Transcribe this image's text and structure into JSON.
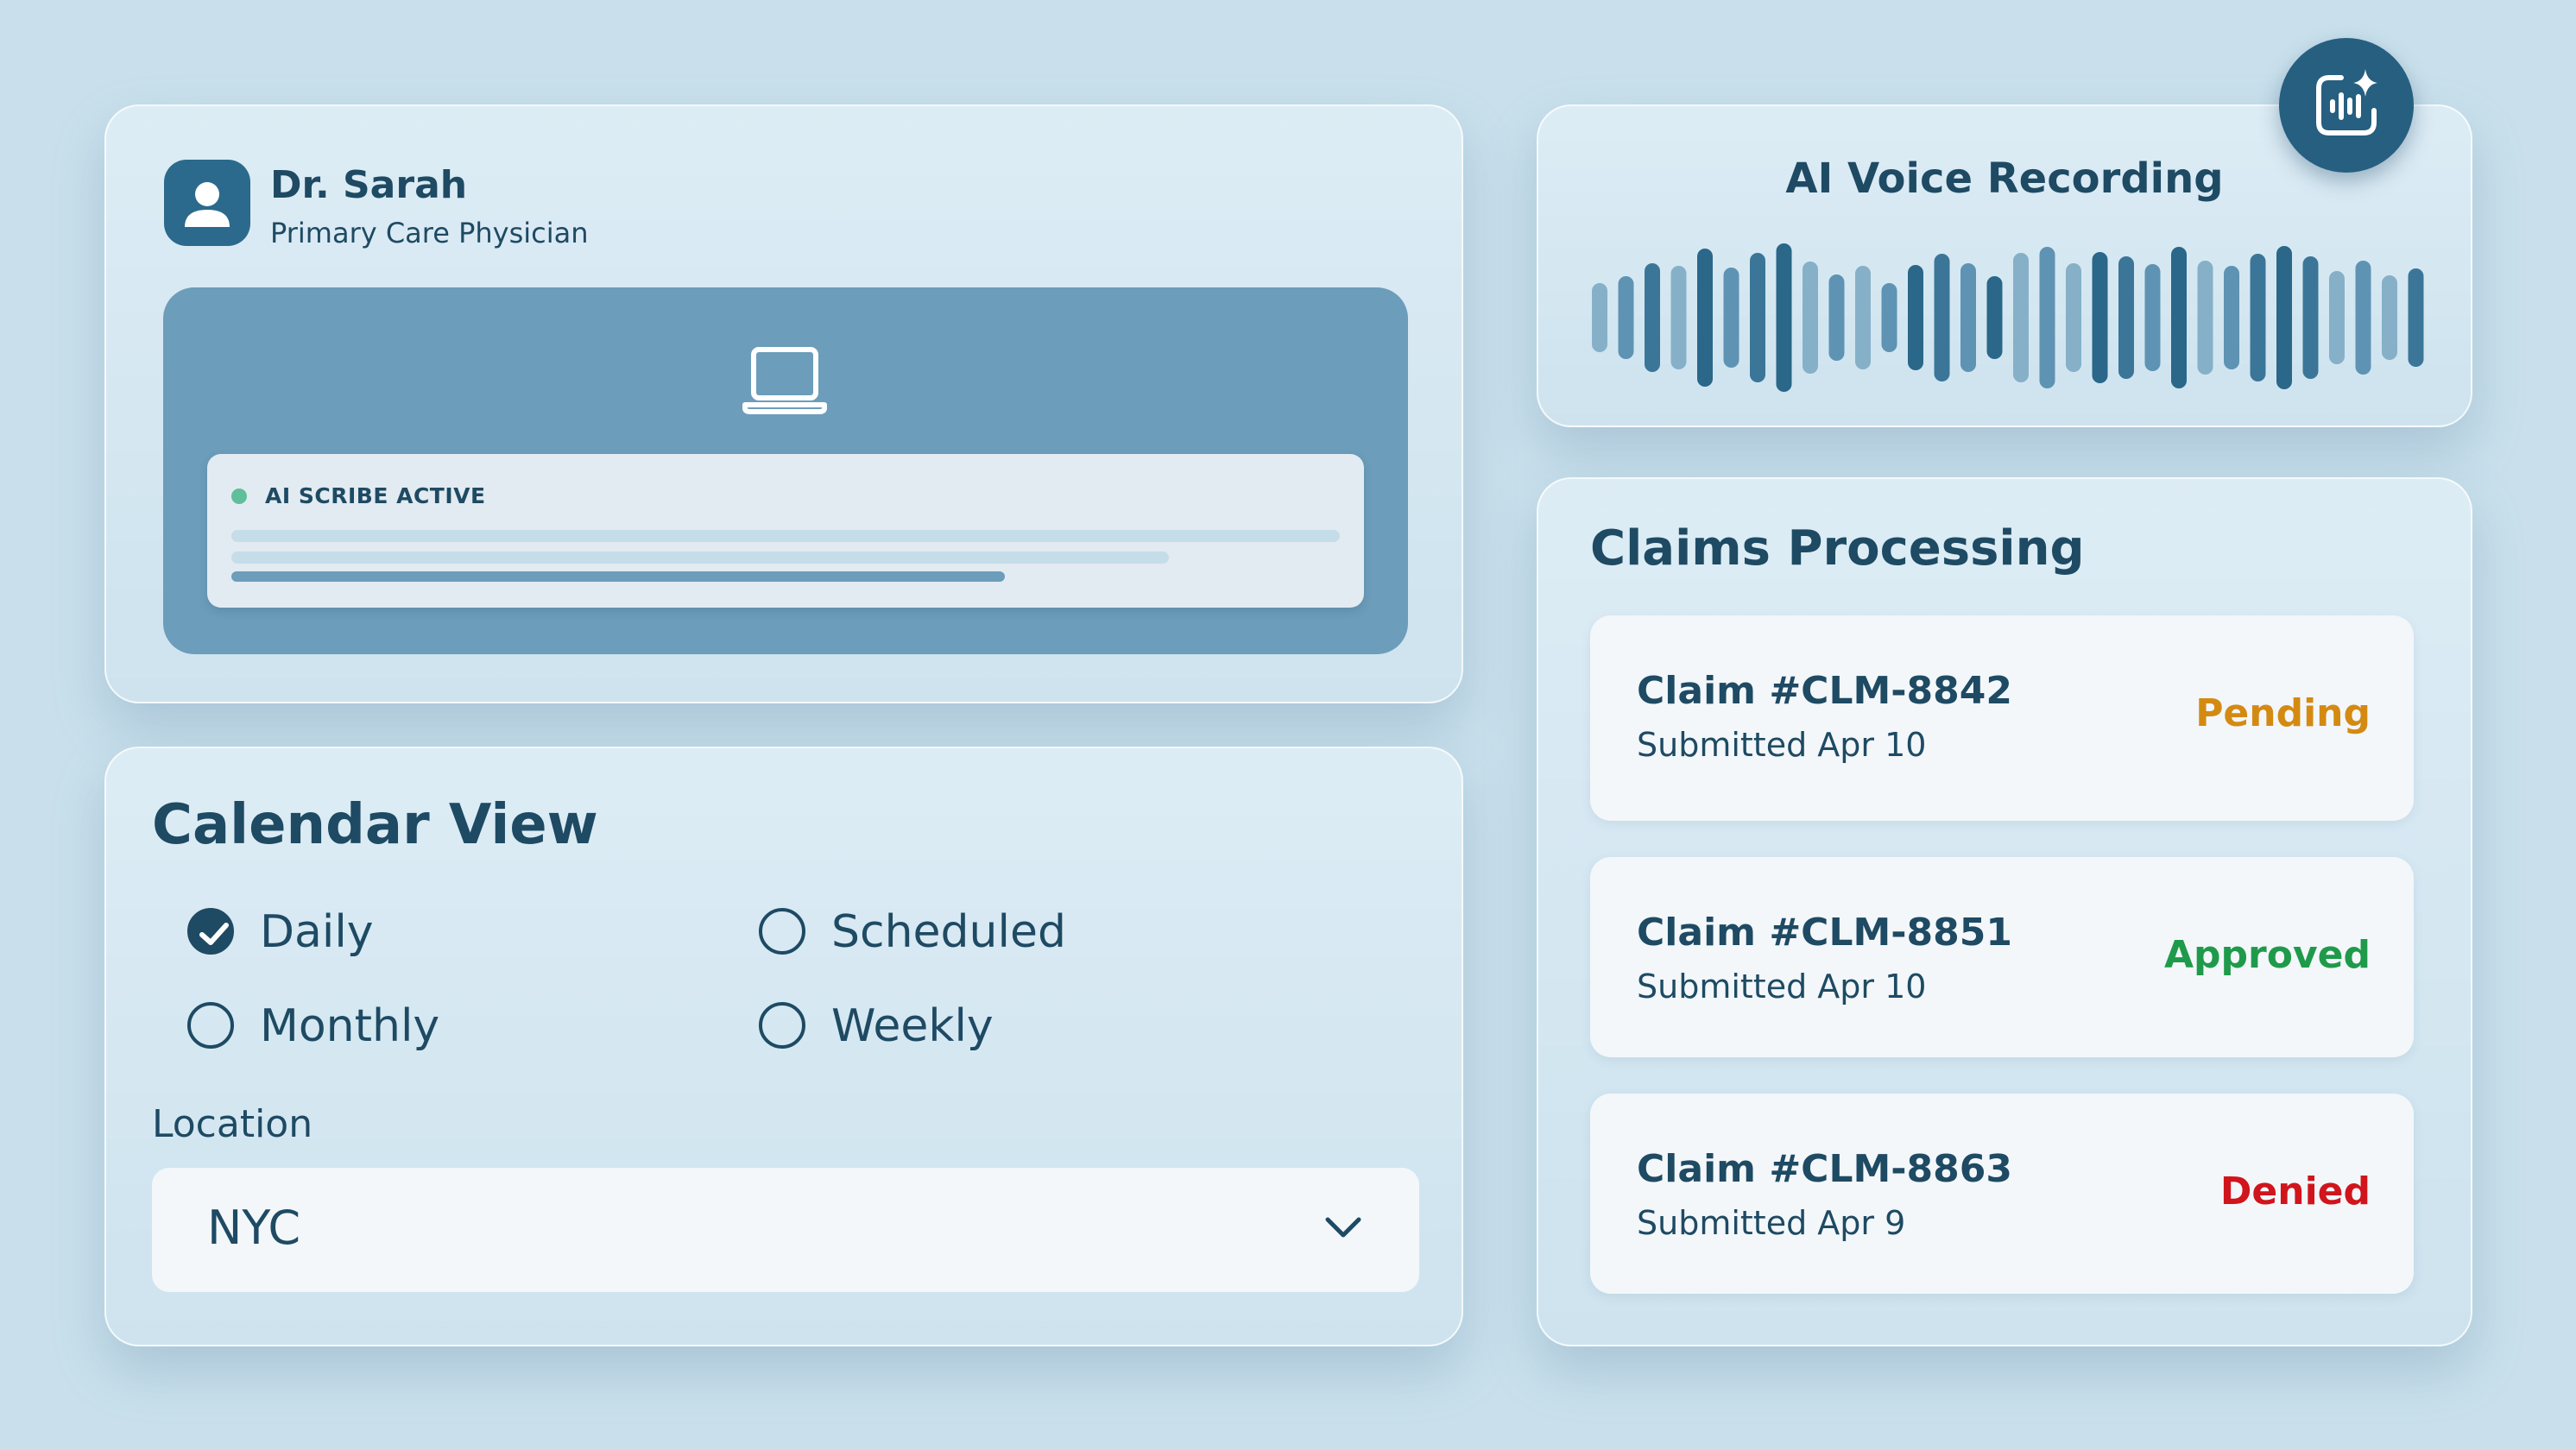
{
  "profile": {
    "name": "Dr. Sarah",
    "role": "Primary Care Physician",
    "avatar_icon": "user-icon",
    "device_icon": "laptop-icon",
    "scribe": {
      "status_label": "AI SCRIBE ACTIVE",
      "status_color": "#5fbf9b"
    }
  },
  "voice": {
    "title": "AI Voice Recording",
    "badge_icon": "ai-voice-sparkle-icon"
  },
  "calendar": {
    "title": "Calendar View",
    "options": [
      {
        "label": "Daily",
        "checked": true
      },
      {
        "label": "Scheduled",
        "checked": false
      },
      {
        "label": "Monthly",
        "checked": false
      },
      {
        "label": "Weekly",
        "checked": false
      }
    ],
    "location_label": "Location",
    "location_value": "NYC"
  },
  "claims": {
    "title": "Claims Processing",
    "items": [
      {
        "id": "Claim #CLM-8842",
        "submitted": "Submitted Apr 10",
        "status": "Pending",
        "status_color": "#d48a12"
      },
      {
        "id": "Claim #CLM-8851",
        "submitted": "Submitted Apr 10",
        "status": "Approved",
        "status_color": "#1f9a4a"
      },
      {
        "id": "Claim #CLM-8863",
        "submitted": "Submitted Apr 9",
        "status": "Denied",
        "status_color": "#d0151c"
      }
    ]
  },
  "colors": {
    "background": "#c9e0ec",
    "primary": "#1e4a63",
    "accent": "#265f80",
    "screen": "#6c9dbb"
  }
}
